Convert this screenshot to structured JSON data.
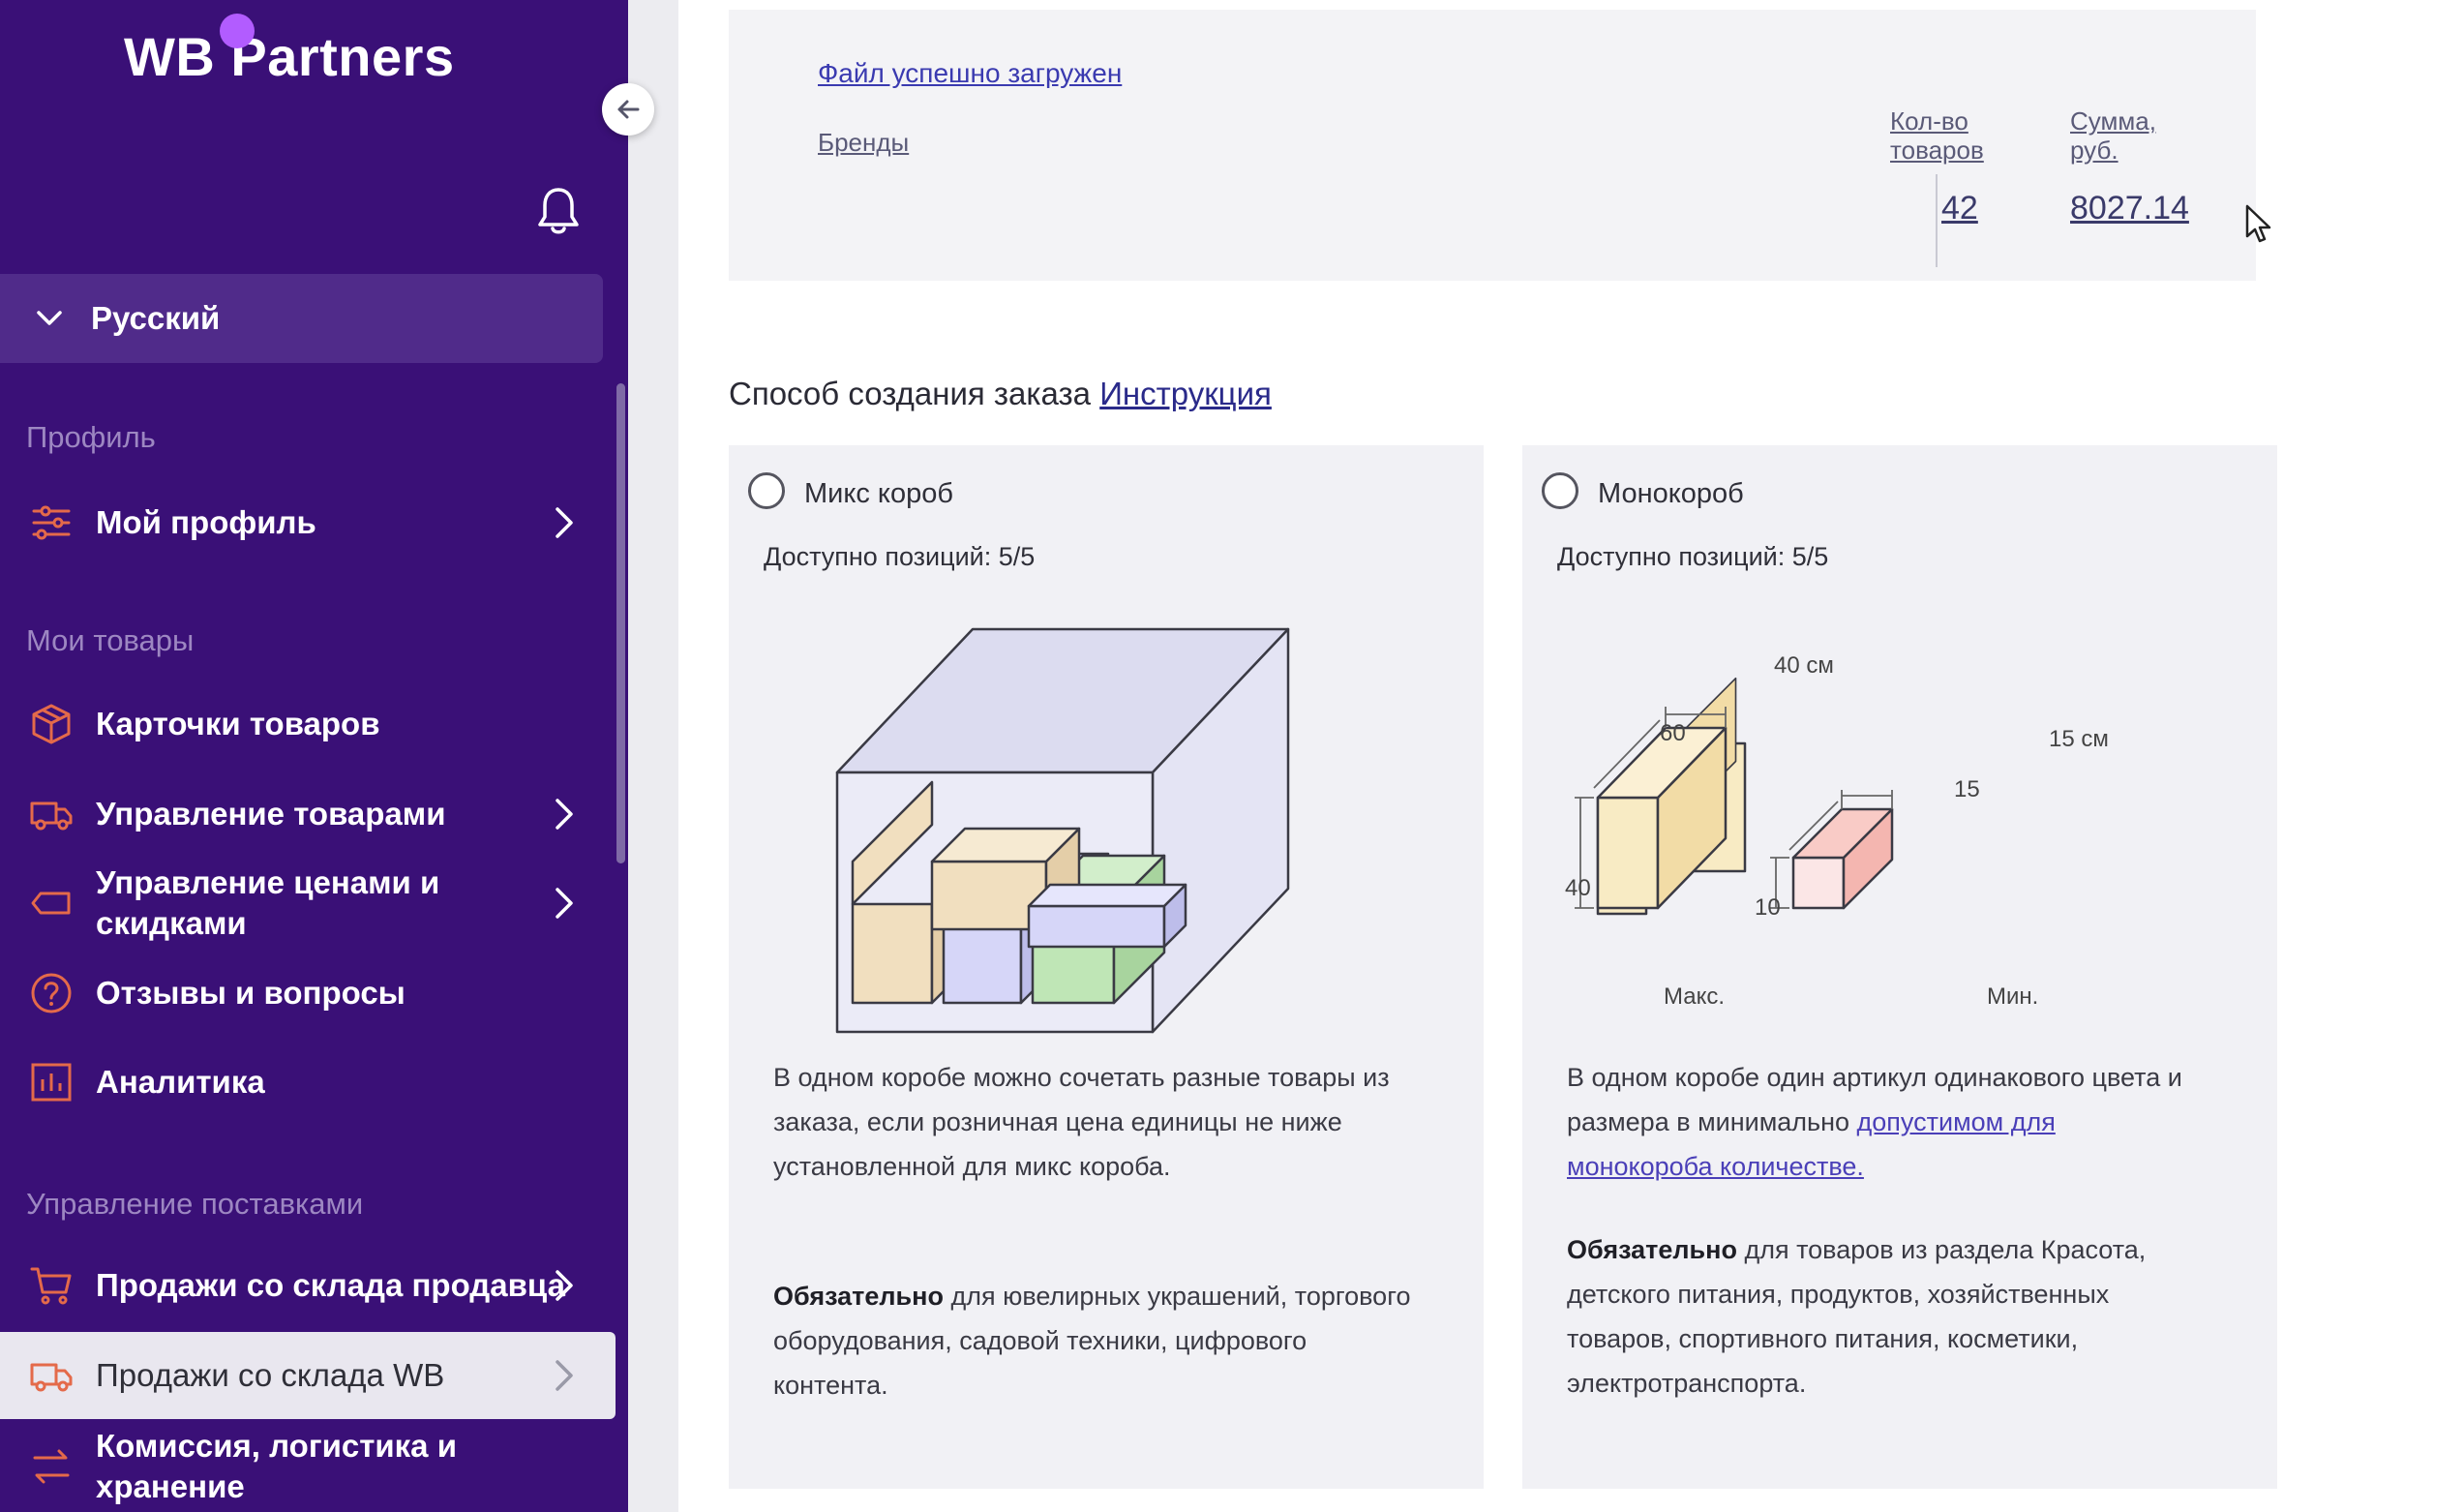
{
  "brand": {
    "logo_text": "WB Partners",
    "accent": "#b25cff",
    "sidebar_bg": "#3a1077"
  },
  "sidebar": {
    "language": "Русский",
    "sections": {
      "profile": "Профиль",
      "my_goods": "Мои товары",
      "supply": "Управление поставками"
    },
    "items": [
      {
        "label": "Мой профиль",
        "icon": "sliders-icon"
      },
      {
        "label": "Карточки товаров",
        "icon": "box-icon"
      },
      {
        "label": "Управление товарами",
        "icon": "truck-icon"
      },
      {
        "label": "Управление ценами и скидками",
        "icon": "tag-icon"
      },
      {
        "label": "Отзывы и вопросы",
        "icon": "question-icon"
      },
      {
        "label": "Аналитика",
        "icon": "chart-icon"
      },
      {
        "label": "Продажи со склада продавца",
        "icon": "cart-icon"
      },
      {
        "label": "Продажи со склада WB",
        "icon": "truck-icon"
      },
      {
        "label": "Комиссия, логистика и хранение",
        "icon": "arrows-icon"
      }
    ]
  },
  "upload": {
    "status": "Файл успешно загружен",
    "brands_header": "Бренды",
    "qty_header": "Кол-во товаров",
    "sum_header": "Сумма, руб.",
    "qty_value": "42",
    "sum_value": "8027.14"
  },
  "method": {
    "title": "Способ создания заказа",
    "instruction_link": "Инструкция"
  },
  "options": {
    "mix": {
      "title": "Микс короб",
      "available": "Доступно позиций: 5/5",
      "description": "В одном коробе можно сочетать разные товары из заказа, если розничная цена единицы не ниже установленной для микс короба.",
      "required_bold": "Обязательно",
      "required_text": " для ювелирных украшений, торгового оборудования, садовой техники, цифрового контента."
    },
    "mono": {
      "title": "Монокороб",
      "available": "Доступно позиций: 5/5",
      "description": "В одном коробе один артикул одинакового цвета и размера в минимально ",
      "description_link": "допустимом для монокороба количестве.",
      "required_bold": "Обязательно",
      "required_text": " для товаров из раздела Красота, детского питания, продуктов, хозяйственных товаров, спортивного питания, косметики, электротранспорта.",
      "max_label": "Макс.",
      "min_label": "Мин.",
      "max_dims": {
        "width": "40 см",
        "length": "60",
        "height": "40"
      },
      "min_dims": {
        "width": "15 см",
        "length": "15",
        "height": "10"
      }
    }
  }
}
